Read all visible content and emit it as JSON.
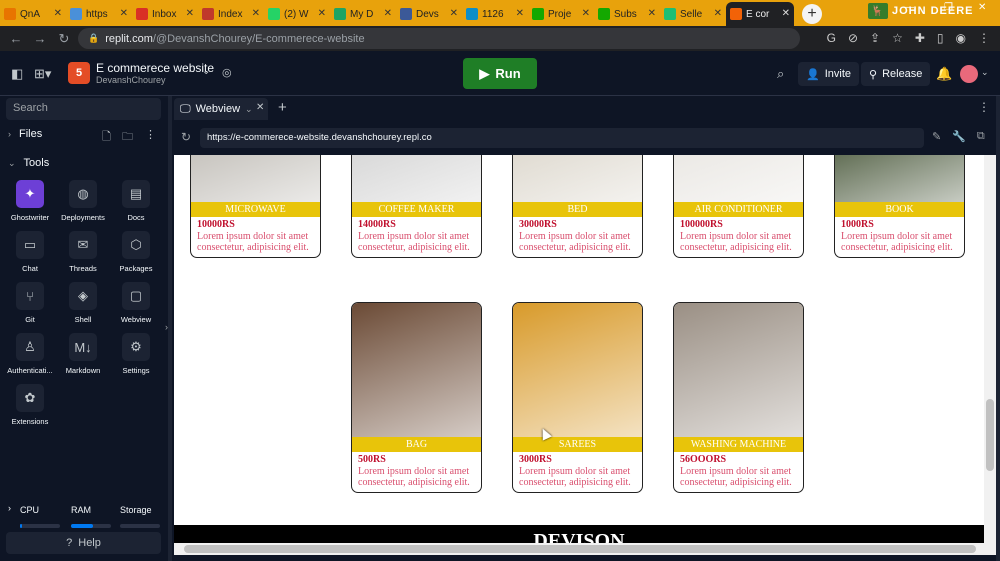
{
  "browser": {
    "tabs": [
      {
        "label": "QnA",
        "icon": "chegg-icon",
        "color": "#e87400"
      },
      {
        "label": "https",
        "icon": "globe-icon",
        "color": "#4a90d9"
      },
      {
        "label": "Inbox",
        "icon": "gmail-icon",
        "color": "#d93025"
      },
      {
        "label": "Index",
        "icon": "doc-icon",
        "color": "#c0392b"
      },
      {
        "label": "(2) W",
        "icon": "whatsapp-icon",
        "color": "#25d366"
      },
      {
        "label": "My D",
        "icon": "drive-icon",
        "color": "#1fa463"
      },
      {
        "label": "Devs",
        "icon": "devs-icon",
        "color": "#3b5998"
      },
      {
        "label": "1126",
        "icon": "chegg-is-icon",
        "color": "#0d8ec7"
      },
      {
        "label": "Proje",
        "icon": "upwork-icon",
        "color": "#14a800"
      },
      {
        "label": "Subs",
        "icon": "upwork-icon",
        "color": "#14a800"
      },
      {
        "label": "Selle",
        "icon": "fiverr-icon",
        "color": "#1dbf73"
      },
      {
        "label": "E cor",
        "icon": "replit-icon",
        "color": "#f26207"
      }
    ],
    "brand": "JOHN DEERE",
    "url_host": "replit.com",
    "url_path": "/@DevanshChourey/E-commerece-website"
  },
  "header": {
    "project_title": "E commerece website",
    "project_owner": "DevanshChourey",
    "run_label": "Run",
    "invite_label": "Invite",
    "release_label": "Release"
  },
  "sidebar": {
    "search_placeholder": "Search",
    "files_label": "Files",
    "tools_label": "Tools",
    "tools": [
      {
        "label": "Ghostwriter",
        "icon": "ghostwriter-icon",
        "glyph": "✦"
      },
      {
        "label": "Deployments",
        "icon": "deployments-icon",
        "glyph": "◍"
      },
      {
        "label": "Docs",
        "icon": "docs-icon",
        "glyph": "▤"
      },
      {
        "label": "Chat",
        "icon": "chat-icon",
        "glyph": "▭"
      },
      {
        "label": "Threads",
        "icon": "threads-icon",
        "glyph": "✉"
      },
      {
        "label": "Packages",
        "icon": "packages-icon",
        "glyph": "⬡"
      },
      {
        "label": "Git",
        "icon": "git-icon",
        "glyph": "⑂"
      },
      {
        "label": "Shell",
        "icon": "shell-icon",
        "glyph": "◈"
      },
      {
        "label": "Webview",
        "icon": "webview-icon",
        "glyph": "▢"
      },
      {
        "label": "Authenticati...",
        "icon": "authentication-icon",
        "glyph": "♙"
      },
      {
        "label": "Markdown",
        "icon": "markdown-icon",
        "glyph": "M↓"
      },
      {
        "label": "Settings",
        "icon": "settings-icon",
        "glyph": "⚙"
      },
      {
        "label": "Extensions",
        "icon": "extensions-icon",
        "glyph": "✿"
      }
    ],
    "resources": {
      "cpu_label": "CPU",
      "ram_label": "RAM",
      "storage_label": "Storage",
      "cpu_fraction": 0.05,
      "ram_fraction": 0.55,
      "storage_fraction": 0.0
    },
    "help_label": "Help"
  },
  "pane": {
    "tab_label": "Webview",
    "url": "https://e-commerece-website.devanshchourey.repl.co"
  },
  "site": {
    "products": [
      {
        "title": "MICROWAVE",
        "price": "10000RS",
        "desc": "Lorem ipsum dolor sit amet consectetur, adipisicing elit.",
        "img_color": "#b9b5ae"
      },
      {
        "title": "COFFEE MAKER",
        "price": "14000RS",
        "desc": "Lorem ipsum dolor sit amet consectetur, adipisicing elit.",
        "img_color": "#cfcfcf"
      },
      {
        "title": "BED",
        "price": "30000RS",
        "desc": "Lorem ipsum dolor sit amet consectetur, adipisicing elit.",
        "img_color": "#d8d2c6"
      },
      {
        "title": "AIR CONDITIONER",
        "price": "100000RS",
        "desc": "Lorem ipsum dolor sit amet consectetur, adipisicing elit.",
        "img_color": "#e6e3de"
      },
      {
        "title": "BOOK",
        "price": "1000RS",
        "desc": "Lorem ipsum dolor sit amet consectetur, adipisicing elit.",
        "img_color": "#3a4a2a"
      },
      {
        "title": "BAG",
        "price": "500RS",
        "desc": "Lorem ipsum dolor sit amet consectetur, adipisicing elit.",
        "img_color": "#6b4a35"
      },
      {
        "title": "SAREES",
        "price": "3000RS",
        "desc": "Lorem ipsum dolor sit amet consectetur, adipisicing elit.",
        "img_color": "#d89a2a"
      },
      {
        "title": "WASHING MACHINE",
        "price": "56OOORS",
        "desc": "Lorem ipsum dolor sit amet consectetur, adipisicing elit.",
        "img_color": "#9a8f84"
      }
    ],
    "footer_text": "DEVISON"
  }
}
